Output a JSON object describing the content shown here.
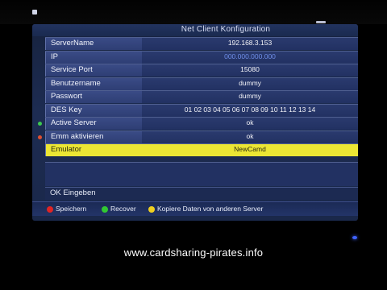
{
  "window": {
    "title": "Net Client Konfiguration"
  },
  "config": {
    "rows": [
      {
        "label": "ServerName",
        "value": "192.168.3.153"
      },
      {
        "label": "IP",
        "value": "000.000.000.000"
      },
      {
        "label": "Service Port",
        "value": "15080"
      },
      {
        "label": "Benutzername",
        "value": "dummy"
      },
      {
        "label": "Passwort",
        "value": "dummy"
      },
      {
        "label": "DES Key",
        "value": "01 02 03 04 05 06 07 08 09 10 11 12 13 14"
      },
      {
        "label": "Active Server",
        "value": "ok"
      },
      {
        "label": "Emm aktivieren",
        "value": "ok"
      },
      {
        "label": "Emulator",
        "value": "NewCamd"
      }
    ],
    "selected_row": "Emulator"
  },
  "status": {
    "ok_text": "OK Eingeben"
  },
  "footer": {
    "legend": [
      {
        "label": "Speichern",
        "color": "#e02424"
      },
      {
        "label": "Recover",
        "color": "#32c832"
      },
      {
        "label": "Kopiere Daten von anderen Server",
        "color": "#f0d020"
      }
    ]
  },
  "colors": {
    "screen_background": "#1d2c52",
    "label_cell": "#3a4b86",
    "selected_row": "#ece634",
    "blue_value_text": "#6f8ee8",
    "row_dot_green": "#3cc850",
    "row_dot_red": "#e05030"
  },
  "watermark": {
    "text": "www.cardsharing-pirates.info"
  }
}
